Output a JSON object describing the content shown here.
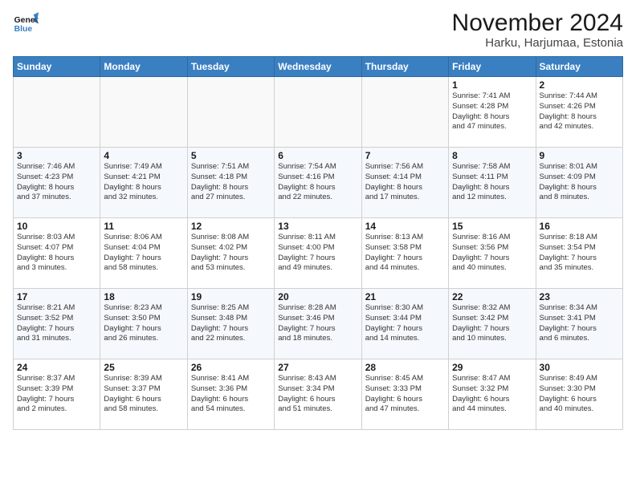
{
  "logo": {
    "line1": "General",
    "line2": "Blue"
  },
  "title": "November 2024",
  "subtitle": "Harku, Harjumaa, Estonia",
  "days_header": [
    "Sunday",
    "Monday",
    "Tuesday",
    "Wednesday",
    "Thursday",
    "Friday",
    "Saturday"
  ],
  "weeks": [
    [
      {
        "day": "",
        "info": ""
      },
      {
        "day": "",
        "info": ""
      },
      {
        "day": "",
        "info": ""
      },
      {
        "day": "",
        "info": ""
      },
      {
        "day": "",
        "info": ""
      },
      {
        "day": "1",
        "info": "Sunrise: 7:41 AM\nSunset: 4:28 PM\nDaylight: 8 hours\nand 47 minutes."
      },
      {
        "day": "2",
        "info": "Sunrise: 7:44 AM\nSunset: 4:26 PM\nDaylight: 8 hours\nand 42 minutes."
      }
    ],
    [
      {
        "day": "3",
        "info": "Sunrise: 7:46 AM\nSunset: 4:23 PM\nDaylight: 8 hours\nand 37 minutes."
      },
      {
        "day": "4",
        "info": "Sunrise: 7:49 AM\nSunset: 4:21 PM\nDaylight: 8 hours\nand 32 minutes."
      },
      {
        "day": "5",
        "info": "Sunrise: 7:51 AM\nSunset: 4:18 PM\nDaylight: 8 hours\nand 27 minutes."
      },
      {
        "day": "6",
        "info": "Sunrise: 7:54 AM\nSunset: 4:16 PM\nDaylight: 8 hours\nand 22 minutes."
      },
      {
        "day": "7",
        "info": "Sunrise: 7:56 AM\nSunset: 4:14 PM\nDaylight: 8 hours\nand 17 minutes."
      },
      {
        "day": "8",
        "info": "Sunrise: 7:58 AM\nSunset: 4:11 PM\nDaylight: 8 hours\nand 12 minutes."
      },
      {
        "day": "9",
        "info": "Sunrise: 8:01 AM\nSunset: 4:09 PM\nDaylight: 8 hours\nand 8 minutes."
      }
    ],
    [
      {
        "day": "10",
        "info": "Sunrise: 8:03 AM\nSunset: 4:07 PM\nDaylight: 8 hours\nand 3 minutes."
      },
      {
        "day": "11",
        "info": "Sunrise: 8:06 AM\nSunset: 4:04 PM\nDaylight: 7 hours\nand 58 minutes."
      },
      {
        "day": "12",
        "info": "Sunrise: 8:08 AM\nSunset: 4:02 PM\nDaylight: 7 hours\nand 53 minutes."
      },
      {
        "day": "13",
        "info": "Sunrise: 8:11 AM\nSunset: 4:00 PM\nDaylight: 7 hours\nand 49 minutes."
      },
      {
        "day": "14",
        "info": "Sunrise: 8:13 AM\nSunset: 3:58 PM\nDaylight: 7 hours\nand 44 minutes."
      },
      {
        "day": "15",
        "info": "Sunrise: 8:16 AM\nSunset: 3:56 PM\nDaylight: 7 hours\nand 40 minutes."
      },
      {
        "day": "16",
        "info": "Sunrise: 8:18 AM\nSunset: 3:54 PM\nDaylight: 7 hours\nand 35 minutes."
      }
    ],
    [
      {
        "day": "17",
        "info": "Sunrise: 8:21 AM\nSunset: 3:52 PM\nDaylight: 7 hours\nand 31 minutes."
      },
      {
        "day": "18",
        "info": "Sunrise: 8:23 AM\nSunset: 3:50 PM\nDaylight: 7 hours\nand 26 minutes."
      },
      {
        "day": "19",
        "info": "Sunrise: 8:25 AM\nSunset: 3:48 PM\nDaylight: 7 hours\nand 22 minutes."
      },
      {
        "day": "20",
        "info": "Sunrise: 8:28 AM\nSunset: 3:46 PM\nDaylight: 7 hours\nand 18 minutes."
      },
      {
        "day": "21",
        "info": "Sunrise: 8:30 AM\nSunset: 3:44 PM\nDaylight: 7 hours\nand 14 minutes."
      },
      {
        "day": "22",
        "info": "Sunrise: 8:32 AM\nSunset: 3:42 PM\nDaylight: 7 hours\nand 10 minutes."
      },
      {
        "day": "23",
        "info": "Sunrise: 8:34 AM\nSunset: 3:41 PM\nDaylight: 7 hours\nand 6 minutes."
      }
    ],
    [
      {
        "day": "24",
        "info": "Sunrise: 8:37 AM\nSunset: 3:39 PM\nDaylight: 7 hours\nand 2 minutes."
      },
      {
        "day": "25",
        "info": "Sunrise: 8:39 AM\nSunset: 3:37 PM\nDaylight: 6 hours\nand 58 minutes."
      },
      {
        "day": "26",
        "info": "Sunrise: 8:41 AM\nSunset: 3:36 PM\nDaylight: 6 hours\nand 54 minutes."
      },
      {
        "day": "27",
        "info": "Sunrise: 8:43 AM\nSunset: 3:34 PM\nDaylight: 6 hours\nand 51 minutes."
      },
      {
        "day": "28",
        "info": "Sunrise: 8:45 AM\nSunset: 3:33 PM\nDaylight: 6 hours\nand 47 minutes."
      },
      {
        "day": "29",
        "info": "Sunrise: 8:47 AM\nSunset: 3:32 PM\nDaylight: 6 hours\nand 44 minutes."
      },
      {
        "day": "30",
        "info": "Sunrise: 8:49 AM\nSunset: 3:30 PM\nDaylight: 6 hours\nand 40 minutes."
      }
    ]
  ]
}
